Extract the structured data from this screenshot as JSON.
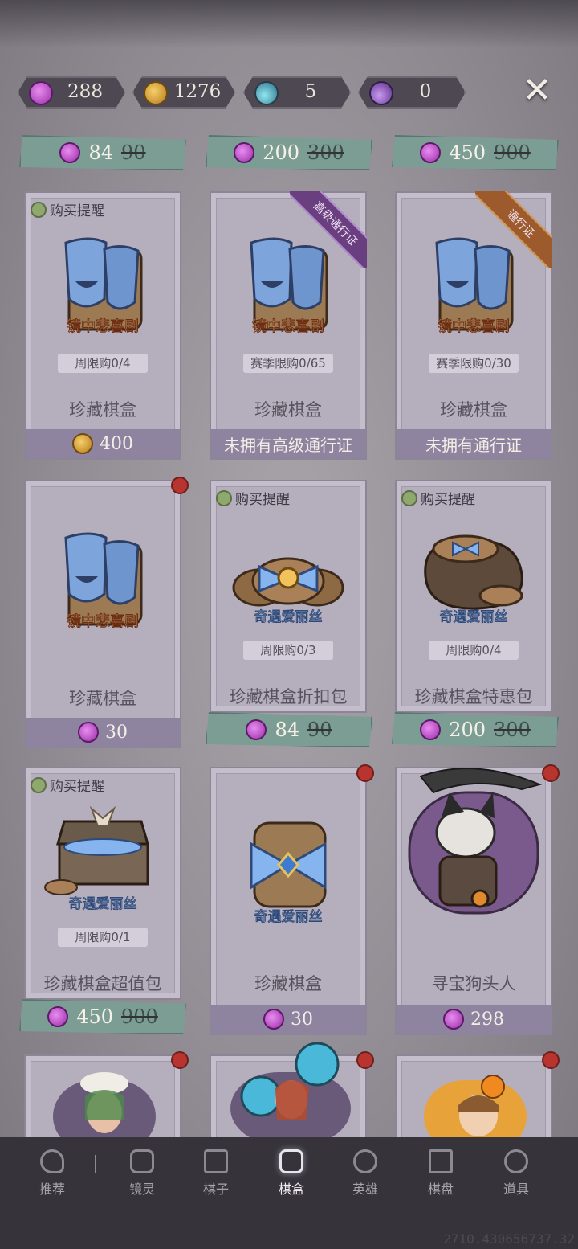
{
  "currencies": [
    {
      "icon": "candy-plus-icon",
      "value": "288"
    },
    {
      "icon": "pumpkin-coin-icon",
      "value": "1276"
    },
    {
      "icon": "blue-potion-icon",
      "value": "5"
    },
    {
      "icon": "purple-potion-icon",
      "value": "0"
    }
  ],
  "close_icon": "close-icon",
  "top_ribbons": [
    {
      "price": "84",
      "original": "90"
    },
    {
      "price": "200",
      "original": "300"
    },
    {
      "price": "450",
      "original": "900"
    }
  ],
  "cards": [
    {
      "remind": "购买提醒",
      "art": "comedy-mask-chest",
      "brand": "镜中悲喜剧",
      "limit": "周限购0/4",
      "name": "珍藏棋盒",
      "price": "400"
    },
    {
      "tag": "高级通行证",
      "art": "comedy-mask-chest",
      "brand": "镜中悲喜剧",
      "limit": "赛季限购0/65",
      "name": "珍藏棋盒",
      "price_text": "未拥有高级通行证"
    },
    {
      "tag": "通行证",
      "art": "comedy-mask-chest",
      "brand": "镜中悲喜剧",
      "limit": "赛季限购0/30",
      "name": "珍藏棋盒",
      "price_text": "未拥有通行证"
    },
    {
      "art": "comedy-mask-chest",
      "brand": "镜中悲喜剧",
      "name": "珍藏棋盒",
      "price": "30"
    },
    {
      "remind": "购买提醒",
      "art": "ribbon-chest-bundle",
      "brand": "奇遇爱丽丝",
      "limit": "周限购0/3",
      "name": "珍藏棋盒折扣包",
      "price": "84",
      "original": "90"
    },
    {
      "remind": "购买提醒",
      "art": "ribbon-chest-sack",
      "brand": "奇遇爱丽丝",
      "limit": "周限购0/4",
      "name": "珍藏棋盒特惠包",
      "price": "200",
      "original": "300"
    },
    {
      "remind": "购买提醒",
      "art": "treasure-chest",
      "brand": "奇遇爱丽丝",
      "limit": "周限购0/1",
      "name": "珍藏棋盒超值包",
      "price": "450",
      "original": "900"
    },
    {
      "art": "ribbon-chest",
      "brand": "奇遇爱丽丝",
      "name": "珍藏棋盒",
      "price": "30"
    },
    {
      "art": "dog-head-hero",
      "name": "寻宝狗头人",
      "price": "298"
    }
  ],
  "nav": [
    {
      "label": "推荐",
      "icon": "recommend-icon"
    },
    {
      "label": "镜灵",
      "icon": "spirit-icon"
    },
    {
      "label": "棋子",
      "icon": "chess-piece-icon"
    },
    {
      "label": "棋盒",
      "icon": "chess-box-icon",
      "active": true
    },
    {
      "label": "英雄",
      "icon": "hero-icon"
    },
    {
      "label": "棋盘",
      "icon": "chessboard-icon"
    },
    {
      "label": "道具",
      "icon": "item-icon"
    }
  ],
  "uid": "2710.430656737.32"
}
